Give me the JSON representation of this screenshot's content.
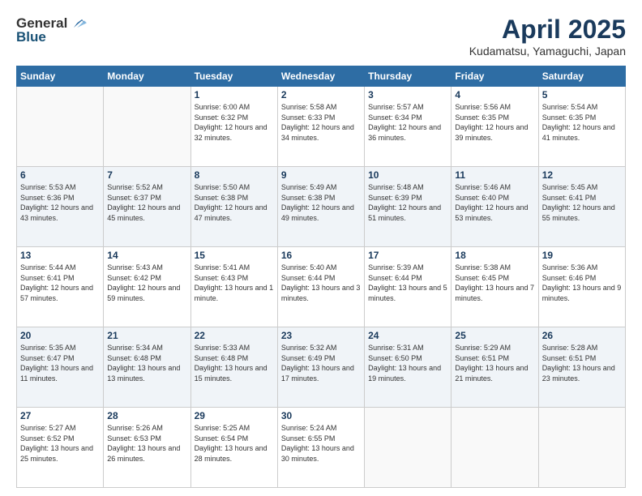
{
  "header": {
    "logo_general": "General",
    "logo_blue": "Blue",
    "title": "April 2025",
    "subtitle": "Kudamatsu, Yamaguchi, Japan"
  },
  "weekdays": [
    "Sunday",
    "Monday",
    "Tuesday",
    "Wednesday",
    "Thursday",
    "Friday",
    "Saturday"
  ],
  "weeks": [
    [
      {
        "day": "",
        "sunrise": "",
        "sunset": "",
        "daylight": ""
      },
      {
        "day": "",
        "sunrise": "",
        "sunset": "",
        "daylight": ""
      },
      {
        "day": "1",
        "sunrise": "Sunrise: 6:00 AM",
        "sunset": "Sunset: 6:32 PM",
        "daylight": "Daylight: 12 hours and 32 minutes."
      },
      {
        "day": "2",
        "sunrise": "Sunrise: 5:58 AM",
        "sunset": "Sunset: 6:33 PM",
        "daylight": "Daylight: 12 hours and 34 minutes."
      },
      {
        "day": "3",
        "sunrise": "Sunrise: 5:57 AM",
        "sunset": "Sunset: 6:34 PM",
        "daylight": "Daylight: 12 hours and 36 minutes."
      },
      {
        "day": "4",
        "sunrise": "Sunrise: 5:56 AM",
        "sunset": "Sunset: 6:35 PM",
        "daylight": "Daylight: 12 hours and 39 minutes."
      },
      {
        "day": "5",
        "sunrise": "Sunrise: 5:54 AM",
        "sunset": "Sunset: 6:35 PM",
        "daylight": "Daylight: 12 hours and 41 minutes."
      }
    ],
    [
      {
        "day": "6",
        "sunrise": "Sunrise: 5:53 AM",
        "sunset": "Sunset: 6:36 PM",
        "daylight": "Daylight: 12 hours and 43 minutes."
      },
      {
        "day": "7",
        "sunrise": "Sunrise: 5:52 AM",
        "sunset": "Sunset: 6:37 PM",
        "daylight": "Daylight: 12 hours and 45 minutes."
      },
      {
        "day": "8",
        "sunrise": "Sunrise: 5:50 AM",
        "sunset": "Sunset: 6:38 PM",
        "daylight": "Daylight: 12 hours and 47 minutes."
      },
      {
        "day": "9",
        "sunrise": "Sunrise: 5:49 AM",
        "sunset": "Sunset: 6:38 PM",
        "daylight": "Daylight: 12 hours and 49 minutes."
      },
      {
        "day": "10",
        "sunrise": "Sunrise: 5:48 AM",
        "sunset": "Sunset: 6:39 PM",
        "daylight": "Daylight: 12 hours and 51 minutes."
      },
      {
        "day": "11",
        "sunrise": "Sunrise: 5:46 AM",
        "sunset": "Sunset: 6:40 PM",
        "daylight": "Daylight: 12 hours and 53 minutes."
      },
      {
        "day": "12",
        "sunrise": "Sunrise: 5:45 AM",
        "sunset": "Sunset: 6:41 PM",
        "daylight": "Daylight: 12 hours and 55 minutes."
      }
    ],
    [
      {
        "day": "13",
        "sunrise": "Sunrise: 5:44 AM",
        "sunset": "Sunset: 6:41 PM",
        "daylight": "Daylight: 12 hours and 57 minutes."
      },
      {
        "day": "14",
        "sunrise": "Sunrise: 5:43 AM",
        "sunset": "Sunset: 6:42 PM",
        "daylight": "Daylight: 12 hours and 59 minutes."
      },
      {
        "day": "15",
        "sunrise": "Sunrise: 5:41 AM",
        "sunset": "Sunset: 6:43 PM",
        "daylight": "Daylight: 13 hours and 1 minute."
      },
      {
        "day": "16",
        "sunrise": "Sunrise: 5:40 AM",
        "sunset": "Sunset: 6:44 PM",
        "daylight": "Daylight: 13 hours and 3 minutes."
      },
      {
        "day": "17",
        "sunrise": "Sunrise: 5:39 AM",
        "sunset": "Sunset: 6:44 PM",
        "daylight": "Daylight: 13 hours and 5 minutes."
      },
      {
        "day": "18",
        "sunrise": "Sunrise: 5:38 AM",
        "sunset": "Sunset: 6:45 PM",
        "daylight": "Daylight: 13 hours and 7 minutes."
      },
      {
        "day": "19",
        "sunrise": "Sunrise: 5:36 AM",
        "sunset": "Sunset: 6:46 PM",
        "daylight": "Daylight: 13 hours and 9 minutes."
      }
    ],
    [
      {
        "day": "20",
        "sunrise": "Sunrise: 5:35 AM",
        "sunset": "Sunset: 6:47 PM",
        "daylight": "Daylight: 13 hours and 11 minutes."
      },
      {
        "day": "21",
        "sunrise": "Sunrise: 5:34 AM",
        "sunset": "Sunset: 6:48 PM",
        "daylight": "Daylight: 13 hours and 13 minutes."
      },
      {
        "day": "22",
        "sunrise": "Sunrise: 5:33 AM",
        "sunset": "Sunset: 6:48 PM",
        "daylight": "Daylight: 13 hours and 15 minutes."
      },
      {
        "day": "23",
        "sunrise": "Sunrise: 5:32 AM",
        "sunset": "Sunset: 6:49 PM",
        "daylight": "Daylight: 13 hours and 17 minutes."
      },
      {
        "day": "24",
        "sunrise": "Sunrise: 5:31 AM",
        "sunset": "Sunset: 6:50 PM",
        "daylight": "Daylight: 13 hours and 19 minutes."
      },
      {
        "day": "25",
        "sunrise": "Sunrise: 5:29 AM",
        "sunset": "Sunset: 6:51 PM",
        "daylight": "Daylight: 13 hours and 21 minutes."
      },
      {
        "day": "26",
        "sunrise": "Sunrise: 5:28 AM",
        "sunset": "Sunset: 6:51 PM",
        "daylight": "Daylight: 13 hours and 23 minutes."
      }
    ],
    [
      {
        "day": "27",
        "sunrise": "Sunrise: 5:27 AM",
        "sunset": "Sunset: 6:52 PM",
        "daylight": "Daylight: 13 hours and 25 minutes."
      },
      {
        "day": "28",
        "sunrise": "Sunrise: 5:26 AM",
        "sunset": "Sunset: 6:53 PM",
        "daylight": "Daylight: 13 hours and 26 minutes."
      },
      {
        "day": "29",
        "sunrise": "Sunrise: 5:25 AM",
        "sunset": "Sunset: 6:54 PM",
        "daylight": "Daylight: 13 hours and 28 minutes."
      },
      {
        "day": "30",
        "sunrise": "Sunrise: 5:24 AM",
        "sunset": "Sunset: 6:55 PM",
        "daylight": "Daylight: 13 hours and 30 minutes."
      },
      {
        "day": "",
        "sunrise": "",
        "sunset": "",
        "daylight": ""
      },
      {
        "day": "",
        "sunrise": "",
        "sunset": "",
        "daylight": ""
      },
      {
        "day": "",
        "sunrise": "",
        "sunset": "",
        "daylight": ""
      }
    ]
  ]
}
